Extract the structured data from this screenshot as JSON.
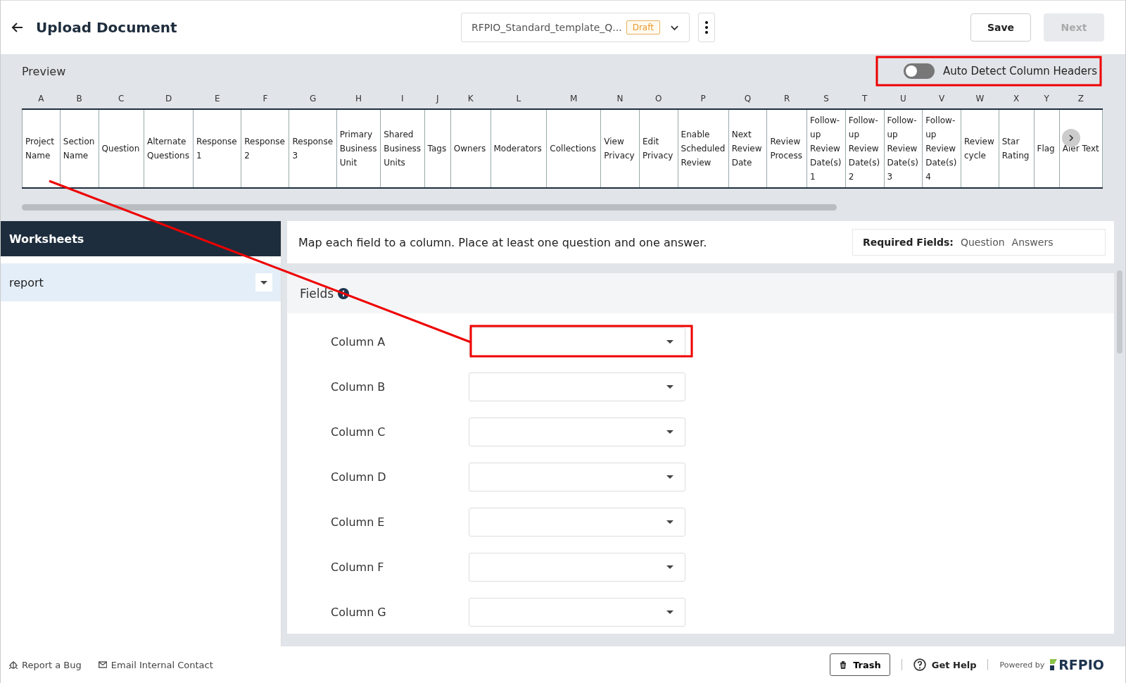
{
  "header": {
    "title": "Upload Document",
    "document": "RFPIO_Standard_template_Q...",
    "badge": "Draft",
    "buttons": [
      {
        "label": "Save",
        "disabled": false
      },
      {
        "label": "Next",
        "disabled": true
      }
    ]
  },
  "preview": {
    "title": "Preview",
    "toggle": {
      "label": "Auto Detect Column Headers",
      "on": false
    },
    "columns": [
      {
        "letter": "A",
        "header": "Project Name"
      },
      {
        "letter": "B",
        "header": "Section Name"
      },
      {
        "letter": "C",
        "header": "Question"
      },
      {
        "letter": "D",
        "header": "Alternate Questions"
      },
      {
        "letter": "E",
        "header": "Response 1"
      },
      {
        "letter": "F",
        "header": "Response 2"
      },
      {
        "letter": "G",
        "header": "Response 3"
      },
      {
        "letter": "H",
        "header": "Primary Business Unit"
      },
      {
        "letter": "I",
        "header": "Shared Business Units"
      },
      {
        "letter": "J",
        "header": "Tags"
      },
      {
        "letter": "K",
        "header": "Owners"
      },
      {
        "letter": "L",
        "header": "Moderators"
      },
      {
        "letter": "M",
        "header": "Collections"
      },
      {
        "letter": "N",
        "header": "View Privacy"
      },
      {
        "letter": "O",
        "header": "Edit Privacy"
      },
      {
        "letter": "P",
        "header": "Enable Scheduled Review"
      },
      {
        "letter": "Q",
        "header": "Next Review Date"
      },
      {
        "letter": "R",
        "header": "Review Process"
      },
      {
        "letter": "S",
        "header": "Follow-up Review Date(s) 1"
      },
      {
        "letter": "T",
        "header": "Follow-up Review Date(s) 2"
      },
      {
        "letter": "U",
        "header": "Follow-up Review Date(s) 3"
      },
      {
        "letter": "V",
        "header": "Follow-up Review Date(s) 4"
      },
      {
        "letter": "W",
        "header": "Review cycle"
      },
      {
        "letter": "X",
        "header": "Star Rating"
      },
      {
        "letter": "Y",
        "header": "Flag"
      },
      {
        "letter": "Z",
        "header": "Aler Text"
      }
    ]
  },
  "worksheets": {
    "title": "Worksheets",
    "items": [
      {
        "label": "report",
        "selected": true
      }
    ]
  },
  "instructions": "Map each field to a column. Place at least one question and one answer.",
  "required": {
    "label": "Required Fields:",
    "fields": [
      "Question",
      "Answers"
    ]
  },
  "fields": {
    "title": "Fields",
    "rows": [
      {
        "label": "Column A"
      },
      {
        "label": "Column B"
      },
      {
        "label": "Column C"
      },
      {
        "label": "Column D"
      },
      {
        "label": "Column E"
      },
      {
        "label": "Column F"
      },
      {
        "label": "Column G"
      }
    ]
  },
  "footer": {
    "links": [
      "Report a Bug",
      "Email Internal Contact"
    ],
    "trash": "Trash",
    "help": "Get Help",
    "powered": "Powered by",
    "brand": "RFPIO"
  }
}
